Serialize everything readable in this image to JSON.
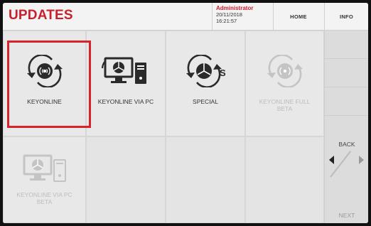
{
  "header": {
    "title": "UPDATES",
    "user": "Administrator",
    "date": "20/11/2018",
    "time": "16:21:57",
    "home_label": "HOME",
    "info_label": "INFO"
  },
  "tiles": [
    {
      "label": "KEYONLINE",
      "icon": "keyonline-sync-icon",
      "enabled": true,
      "selected": true
    },
    {
      "label": "KEYONLINE VIA PC",
      "icon": "pc-tower-icon",
      "enabled": true
    },
    {
      "label": "SPECIAL",
      "icon": "special-sync-icon",
      "enabled": true
    },
    {
      "label": "KEYONLINE FULL BETA",
      "icon": "keyonline-sync-icon",
      "enabled": false
    },
    {
      "label": "KEYONLINE VIA PC BETA",
      "icon": "pc-tower-icon",
      "enabled": false
    }
  ],
  "nav": {
    "back_label": "BACK",
    "next_label": "NEXT"
  },
  "colors": {
    "accent": "#c8202e",
    "selection": "#d8232a",
    "icon": "#2a2a2a",
    "icon_disabled": "#c4c4c4"
  }
}
